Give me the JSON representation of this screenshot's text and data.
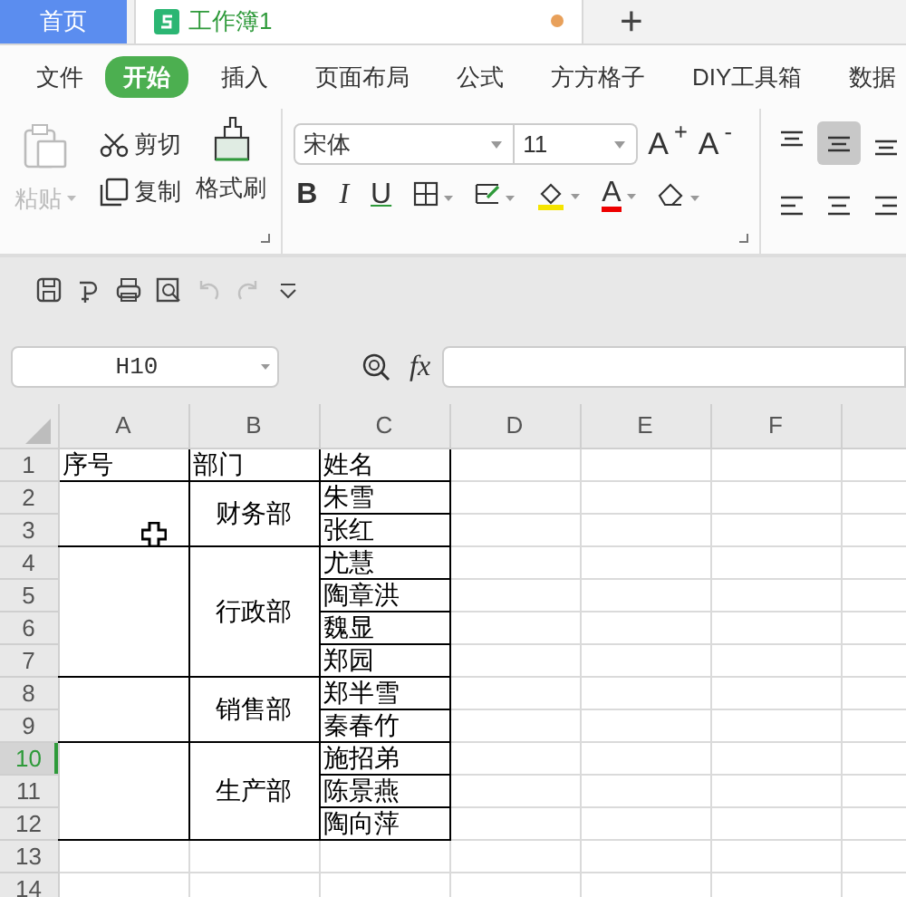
{
  "tabs": [
    {
      "label": "首页",
      "kind": "home",
      "selected": false
    },
    {
      "label": "工作簿1",
      "kind": "sheet",
      "selected": true,
      "unsaved": true
    }
  ],
  "new_tab": "+",
  "menu": {
    "file": "文件",
    "items": [
      {
        "label": "开始",
        "selected": true
      },
      {
        "label": "插入",
        "selected": false
      },
      {
        "label": "页面布局",
        "selected": false
      },
      {
        "label": "公式",
        "selected": false
      },
      {
        "label": "方方格子",
        "selected": false
      },
      {
        "label": "DIY工具箱",
        "selected": false
      },
      {
        "label": "数据",
        "selected": false
      }
    ]
  },
  "clipboard": {
    "paste": {
      "label": "粘贴",
      "disabled": true
    },
    "cut": "剪切",
    "copy": "复制",
    "format_painter": "格式刷"
  },
  "font": {
    "name": "宋体",
    "size": "11",
    "grow": "A$^{+}$",
    "shrink": "A$^{-}$",
    "bold": "B",
    "italic": "I",
    "underline": "U",
    "font_color": "A"
  },
  "align_buttons": [
    {
      "kind": "top",
      "selected": false
    },
    {
      "kind": "middle",
      "selected": true
    },
    {
      "kind": "bottom",
      "selected": false
    },
    {
      "kind": "left",
      "selected": false
    },
    {
      "kind": "center",
      "selected": false
    },
    {
      "kind": "right",
      "selected": false
    }
  ],
  "quick_access": [
    {
      "kind": "save",
      "disabled": false
    },
    {
      "kind": "export",
      "disabled": false
    },
    {
      "kind": "print",
      "disabled": false
    },
    {
      "kind": "preview",
      "disabled": false
    },
    {
      "kind": "undo",
      "disabled": true
    },
    {
      "kind": "redo",
      "disabled": true
    },
    {
      "kind": "more",
      "disabled": false
    }
  ],
  "name_box": "H10",
  "fx": "fx",
  "sheet": {
    "columns": [
      "A",
      "B",
      "C",
      "D",
      "E",
      "F"
    ],
    "rows": [
      {
        "label": "1",
        "selected": false
      },
      {
        "label": "2",
        "selected": false
      },
      {
        "label": "3",
        "selected": false
      },
      {
        "label": "4",
        "selected": false
      },
      {
        "label": "5",
        "selected": false
      },
      {
        "label": "6",
        "selected": false
      },
      {
        "label": "7",
        "selected": false
      },
      {
        "label": "8",
        "selected": false
      },
      {
        "label": "9",
        "selected": false
      },
      {
        "label": "10",
        "selected": true
      },
      {
        "label": "11",
        "selected": false
      },
      {
        "label": "12",
        "selected": false
      },
      {
        "label": "13",
        "selected": false
      },
      {
        "label": "14",
        "selected": false
      }
    ],
    "header": [
      "序号",
      "部门",
      "姓名"
    ],
    "groups": [
      {
        "department": "财务部",
        "names": [
          "朱雪",
          "张红"
        ]
      },
      {
        "department": "行政部",
        "names": [
          "尤慧",
          "陶章洪",
          "魏显",
          "郑园"
        ]
      },
      {
        "department": "销售部",
        "names": [
          "郑半雪",
          "秦春竹"
        ]
      },
      {
        "department": "生产部",
        "names": [
          "施招弟",
          "陈景燕",
          "陶向萍"
        ]
      }
    ]
  }
}
